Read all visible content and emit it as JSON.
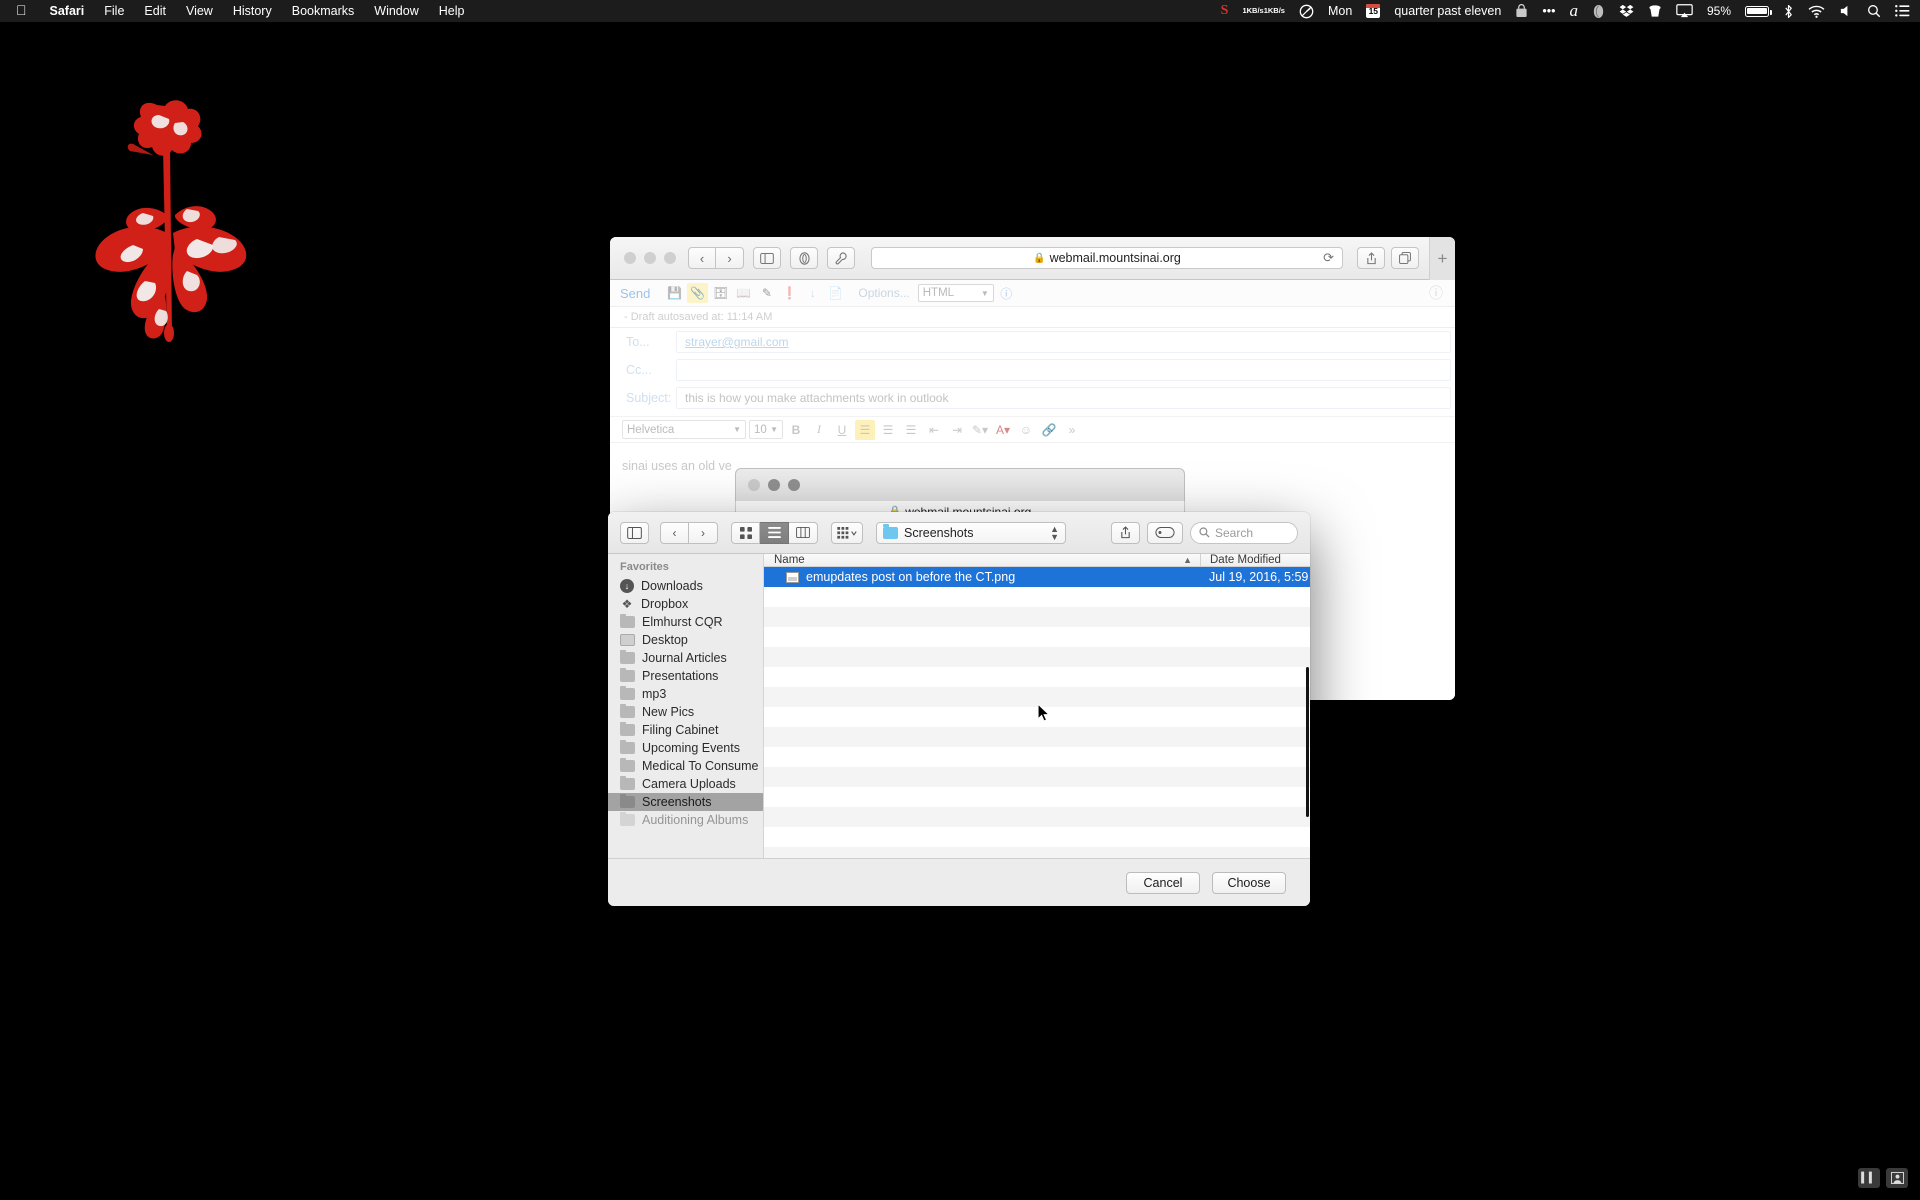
{
  "menubar": {
    "apple_icon": "apple-icon",
    "app_name": "Safari",
    "items": [
      "File",
      "Edit",
      "View",
      "History",
      "Bookmarks",
      "Window",
      "Help"
    ],
    "status": {
      "s_icon": "s-letter-icon",
      "net_up": "1KB/s",
      "net_down": "1KB/s",
      "speedometer_icon": "speedometer-icon",
      "day": "Mon",
      "date_number": "15",
      "time_text": "quarter past eleven",
      "bag_icon": "bag-icon",
      "ellipsis_icon": "ellipsis-icon",
      "alfred_icon": "alfred-icon",
      "evernote_icon": "evernote-icon",
      "dropbox_icon": "dropbox-icon",
      "trash_icon": "trash-icon",
      "airplay_icon": "airplay-icon",
      "battery_percent": "95%",
      "battery_icon": "battery-icon",
      "bluetooth_icon": "bluetooth-icon",
      "wifi_icon": "wifi-icon",
      "volume_icon": "volume-icon",
      "search_icon": "spotlight-search-icon",
      "notification_icon": "notification-center-icon"
    }
  },
  "desktop": {
    "wallpaper_name": "violator-rose-wallpaper",
    "rose_color": "#d02017",
    "background_color": "#000000"
  },
  "safari": {
    "traffic_lights": [
      "close",
      "minimize",
      "zoom"
    ],
    "back_icon": "chevron-left-icon",
    "forward_icon": "chevron-right-icon",
    "sidebar_icon": "sidebar-icon",
    "reader_icon": "reader-icon",
    "customize_icon": "wrench-icon",
    "url": "webmail.mountsinai.org",
    "lock_icon": "lock-icon",
    "reload_icon": "reload-icon",
    "share_icon": "share-icon",
    "tabs_icon": "tab-overview-icon",
    "new_tab_label": "+"
  },
  "webmail": {
    "send_label": "Send",
    "toolbar_icons": [
      "save-icon",
      "attachment-icon",
      "address-book-icon",
      "contacts-icon",
      "spellcheck-icon",
      "priority-icon",
      "download-icon",
      "signature-icon"
    ],
    "options_label": "Options...",
    "format_value": "HTML",
    "info_icon": "info-icon",
    "help_icon": "help-icon",
    "draft_status": "- Draft autosaved at: 11:14 AM",
    "fields": [
      {
        "label": "To...",
        "value": "strayer@gmail.com",
        "placeholder": ""
      },
      {
        "label": "Cc...",
        "value": "",
        "placeholder": ""
      },
      {
        "label": "Subject:",
        "value": "this is how you make attachments work in outlook",
        "placeholder": ""
      }
    ],
    "format_bar": {
      "font_family": "Helvetica",
      "font_size": "10",
      "bold": "B",
      "italic": "I",
      "underline": "U",
      "align_left_icon": "align-left-icon",
      "align_center_icon": "align-center-icon",
      "align_right_icon": "align-right-icon",
      "indent_decrease_icon": "outdent-icon",
      "indent_increase_icon": "indent-icon",
      "highlight_icon": "highlight-color-icon",
      "text_color_icon": "text-color-icon",
      "emoji_icon": "emoji-icon",
      "link_icon": "insert-link-icon",
      "more_icon": "more-chevron-icon"
    },
    "body_text": "sinai uses an old ve"
  },
  "sheet_window": {
    "url": "webmail.mountsinai.org",
    "lock_icon": "lock-icon"
  },
  "file_dialog": {
    "toolbar": {
      "sidebar_icon": "sidebar-toggle-icon",
      "back_icon": "chevron-left-icon",
      "forward_icon": "chevron-right-icon",
      "icon_view_icon": "icon-view-icon",
      "list_view_icon": "list-view-icon",
      "column_view_icon": "column-view-icon",
      "arrange_icon": "arrange-by-icon",
      "current_folder": "Screenshots",
      "share_icon": "share-icon",
      "tag_icon": "tag-icon",
      "search_icon": "search-icon",
      "search_placeholder": "Search"
    },
    "sidebar": {
      "header": "Favorites",
      "items": [
        {
          "label": "Downloads",
          "icon": "downloads-icon",
          "selected": false
        },
        {
          "label": "Dropbox",
          "icon": "dropbox-icon",
          "selected": false
        },
        {
          "label": "Elmhurst CQR",
          "icon": "folder-icon",
          "selected": false
        },
        {
          "label": "Desktop",
          "icon": "desktop-icon",
          "selected": false
        },
        {
          "label": "Journal Articles",
          "icon": "folder-icon",
          "selected": false
        },
        {
          "label": "Presentations",
          "icon": "folder-icon",
          "selected": false
        },
        {
          "label": "mp3",
          "icon": "folder-icon",
          "selected": false
        },
        {
          "label": "New Pics",
          "icon": "folder-icon",
          "selected": false
        },
        {
          "label": "Filing Cabinet",
          "icon": "folder-icon",
          "selected": false
        },
        {
          "label": "Upcoming Events",
          "icon": "folder-icon",
          "selected": false
        },
        {
          "label": "Medical To Consume",
          "icon": "folder-icon",
          "selected": false
        },
        {
          "label": "Camera Uploads",
          "icon": "folder-icon",
          "selected": false
        },
        {
          "label": "Screenshots",
          "icon": "folder-icon",
          "selected": true
        },
        {
          "label": "Auditioning Albums",
          "icon": "folder-icon",
          "selected": false
        }
      ]
    },
    "columns": {
      "name": "Name",
      "date_modified": "Date Modified",
      "sort_arrow": "▲"
    },
    "rows": [
      {
        "name": "emupdates post on before the CT.png",
        "date": "Jul 19, 2016, 5:59",
        "icon": "png-file-icon",
        "selected": true
      }
    ],
    "buttons": {
      "cancel": "Cancel",
      "choose": "Choose"
    },
    "accent_color": "#1e73d8"
  },
  "bottom_right": {
    "pause_icon": "pause-icon",
    "presenter_icon": "presenter-overlay-icon"
  }
}
